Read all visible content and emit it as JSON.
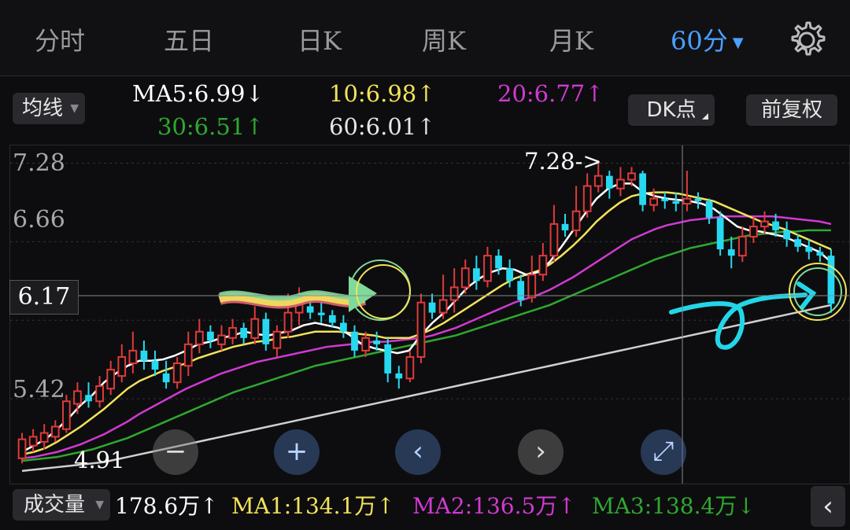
{
  "tabs": [
    {
      "label": "分时",
      "active": false
    },
    {
      "label": "五日",
      "active": false
    },
    {
      "label": "日K",
      "active": false
    },
    {
      "label": "周K",
      "active": false
    },
    {
      "label": "月K",
      "active": false
    },
    {
      "label": "60分",
      "active": true
    }
  ],
  "tab_active_caret": "▼",
  "ma_selector": "均线",
  "ma_values": {
    "ma5": "MA5:6.99↓",
    "ma10": "10:6.98↑",
    "ma20": "20:6.77↑",
    "ma30": "30:6.51↑",
    "ma60": "60:6.01↑"
  },
  "dk_button": "DK点",
  "adjust_button": "前复权",
  "price_axis": [
    "7.28",
    "6.66",
    "5.42"
  ],
  "current_price": "6.17",
  "high_marker": "7.28->",
  "low_marker": "4.91",
  "zoom_controls": {
    "minus": "−",
    "plus": "+",
    "prev": "‹",
    "next": "›",
    "expand": "⤢"
  },
  "volume_bar": {
    "selector": "成交量",
    "vol": "178.6万↑",
    "ma1": "MA1:134.1万↑",
    "ma2": "MA2:136.5万↑",
    "ma3": "MA3:138.4万↓"
  },
  "collapse_button": "‹",
  "colors": {
    "up": "#e03a3a",
    "down": "#27d9f0",
    "ma5": "#ffffff",
    "ma10": "#f2e35a",
    "ma20": "#d13ad1",
    "ma30": "#2fa82f",
    "ma60": "#d0d0d0",
    "accent": "#4aa0ff"
  },
  "chart_data": {
    "type": "candlestick",
    "ylim": [
      4.75,
      7.42
    ],
    "candles": [
      {
        "o": 4.95,
        "c": 5.1,
        "h": 5.15,
        "l": 4.91
      },
      {
        "o": 5.05,
        "c": 5.12,
        "h": 5.18,
        "l": 5.0
      },
      {
        "o": 5.08,
        "c": 5.15,
        "h": 5.22,
        "l": 5.02
      },
      {
        "o": 5.12,
        "c": 5.2,
        "h": 5.25,
        "l": 5.08
      },
      {
        "o": 5.18,
        "c": 5.4,
        "h": 5.45,
        "l": 5.15
      },
      {
        "o": 5.38,
        "c": 5.48,
        "h": 5.55,
        "l": 5.3
      },
      {
        "o": 5.45,
        "c": 5.4,
        "h": 5.55,
        "l": 5.35
      },
      {
        "o": 5.4,
        "c": 5.52,
        "h": 5.6,
        "l": 5.35
      },
      {
        "o": 5.5,
        "c": 5.65,
        "h": 5.72,
        "l": 5.45
      },
      {
        "o": 5.6,
        "c": 5.75,
        "h": 5.85,
        "l": 5.55
      },
      {
        "o": 5.7,
        "c": 5.8,
        "h": 5.95,
        "l": 5.62
      },
      {
        "o": 5.8,
        "c": 5.72,
        "h": 5.88,
        "l": 5.65
      },
      {
        "o": 5.72,
        "c": 5.65,
        "h": 5.8,
        "l": 5.6
      },
      {
        "o": 5.62,
        "c": 5.55,
        "h": 5.72,
        "l": 5.5
      },
      {
        "o": 5.55,
        "c": 5.7,
        "h": 5.75,
        "l": 5.5
      },
      {
        "o": 5.68,
        "c": 5.85,
        "h": 5.95,
        "l": 5.6
      },
      {
        "o": 5.85,
        "c": 5.95,
        "h": 6.05,
        "l": 5.78
      },
      {
        "o": 5.95,
        "c": 5.88,
        "h": 6.0,
        "l": 5.82
      },
      {
        "o": 5.85,
        "c": 5.92,
        "h": 6.0,
        "l": 5.8
      },
      {
        "o": 5.9,
        "c": 5.98,
        "h": 6.05,
        "l": 5.85
      },
      {
        "o": 5.98,
        "c": 5.9,
        "h": 6.02,
        "l": 5.85
      },
      {
        "o": 5.9,
        "c": 6.05,
        "h": 6.15,
        "l": 5.85
      },
      {
        "o": 6.05,
        "c": 5.85,
        "h": 6.1,
        "l": 5.8
      },
      {
        "o": 5.82,
        "c": 5.95,
        "h": 6.0,
        "l": 5.75
      },
      {
        "o": 5.95,
        "c": 6.1,
        "h": 6.25,
        "l": 5.9
      },
      {
        "o": 6.1,
        "c": 6.18,
        "h": 6.3,
        "l": 6.0
      },
      {
        "o": 6.15,
        "c": 6.1,
        "h": 6.2,
        "l": 6.05
      },
      {
        "o": 6.1,
        "c": 6.08,
        "h": 6.18,
        "l": 6.02
      },
      {
        "o": 6.08,
        "c": 6.02,
        "h": 6.12,
        "l": 5.98
      },
      {
        "o": 6.02,
        "c": 5.95,
        "h": 6.08,
        "l": 5.9
      },
      {
        "o": 5.95,
        "c": 5.8,
        "h": 6.0,
        "l": 5.75
      },
      {
        "o": 5.8,
        "c": 5.9,
        "h": 5.95,
        "l": 5.75
      },
      {
        "o": 5.88,
        "c": 5.85,
        "h": 5.95,
        "l": 5.8
      },
      {
        "o": 5.85,
        "c": 5.62,
        "h": 5.9,
        "l": 5.55
      },
      {
        "o": 5.62,
        "c": 5.58,
        "h": 5.68,
        "l": 5.5
      },
      {
        "o": 5.58,
        "c": 5.75,
        "h": 5.8,
        "l": 5.55
      },
      {
        "o": 5.75,
        "c": 6.18,
        "h": 6.25,
        "l": 5.7
      },
      {
        "o": 6.18,
        "c": 6.1,
        "h": 6.25,
        "l": 6.05
      },
      {
        "o": 6.1,
        "c": 6.2,
        "h": 6.4,
        "l": 6.05
      },
      {
        "o": 6.2,
        "c": 6.3,
        "h": 6.45,
        "l": 6.1
      },
      {
        "o": 6.3,
        "c": 6.45,
        "h": 6.52,
        "l": 6.25
      },
      {
        "o": 6.45,
        "c": 6.35,
        "h": 6.55,
        "l": 6.28
      },
      {
        "o": 6.35,
        "c": 6.55,
        "h": 6.62,
        "l": 6.3
      },
      {
        "o": 6.55,
        "c": 6.45,
        "h": 6.6,
        "l": 6.4
      },
      {
        "o": 6.45,
        "c": 6.35,
        "h": 6.52,
        "l": 6.3
      },
      {
        "o": 6.35,
        "c": 6.2,
        "h": 6.4,
        "l": 6.15
      },
      {
        "o": 6.22,
        "c": 6.4,
        "h": 6.55,
        "l": 6.18
      },
      {
        "o": 6.4,
        "c": 6.55,
        "h": 6.65,
        "l": 6.35
      },
      {
        "o": 6.55,
        "c": 6.8,
        "h": 6.95,
        "l": 6.5
      },
      {
        "o": 6.8,
        "c": 6.75,
        "h": 6.88,
        "l": 6.7
      },
      {
        "o": 6.75,
        "c": 6.9,
        "h": 7.1,
        "l": 6.7
      },
      {
        "o": 6.9,
        "c": 7.1,
        "h": 7.2,
        "l": 6.85
      },
      {
        "o": 7.1,
        "c": 7.18,
        "h": 7.28,
        "l": 7.05
      },
      {
        "o": 7.18,
        "c": 7.08,
        "h": 7.22,
        "l": 7.0
      },
      {
        "o": 7.08,
        "c": 7.15,
        "h": 7.25,
        "l": 7.02
      },
      {
        "o": 7.15,
        "c": 7.2,
        "h": 7.25,
        "l": 7.1
      },
      {
        "o": 7.2,
        "c": 6.95,
        "h": 7.22,
        "l": 6.9
      },
      {
        "o": 6.95,
        "c": 7.0,
        "h": 7.08,
        "l": 6.9
      },
      {
        "o": 7.0,
        "c": 6.98,
        "h": 7.05,
        "l": 6.92
      },
      {
        "o": 6.98,
        "c": 6.96,
        "h": 7.05,
        "l": 6.9
      },
      {
        "o": 6.96,
        "c": 7.0,
        "h": 7.22,
        "l": 6.9
      },
      {
        "o": 7.0,
        "c": 6.98,
        "h": 7.05,
        "l": 6.92
      },
      {
        "o": 6.98,
        "c": 6.85,
        "h": 7.0,
        "l": 6.8
      },
      {
        "o": 6.85,
        "c": 6.6,
        "h": 6.9,
        "l": 6.55
      },
      {
        "o": 6.6,
        "c": 6.55,
        "h": 6.7,
        "l": 6.45
      },
      {
        "o": 6.55,
        "c": 6.7,
        "h": 6.78,
        "l": 6.5
      },
      {
        "o": 6.7,
        "c": 6.78,
        "h": 6.85,
        "l": 6.65
      },
      {
        "o": 6.78,
        "c": 6.82,
        "h": 6.9,
        "l": 6.72
      },
      {
        "o": 6.82,
        "c": 6.75,
        "h": 6.88,
        "l": 6.7
      },
      {
        "o": 6.75,
        "c": 6.68,
        "h": 6.82,
        "l": 6.62
      },
      {
        "o": 6.68,
        "c": 6.62,
        "h": 6.72,
        "l": 6.58
      },
      {
        "o": 6.62,
        "c": 6.58,
        "h": 6.68,
        "l": 6.52
      },
      {
        "o": 6.58,
        "c": 6.55,
        "h": 6.62,
        "l": 6.5
      },
      {
        "o": 6.55,
        "c": 6.17,
        "h": 6.6,
        "l": 6.1
      }
    ],
    "ma_lines": {
      "ma5": [
        5.0,
        5.05,
        5.1,
        5.18,
        5.27,
        5.37,
        5.45,
        5.55,
        5.62,
        5.68,
        5.72,
        5.72,
        5.73,
        5.76,
        5.8,
        5.85,
        5.87,
        5.9,
        5.92,
        5.95,
        5.93,
        5.92,
        5.94,
        5.96,
        6.0,
        6.02,
        6.0,
        5.98,
        5.92,
        5.85,
        5.82,
        5.8,
        5.78,
        5.8,
        5.92,
        6.02,
        6.1,
        6.2,
        6.3,
        6.37,
        6.42,
        6.45,
        6.44,
        6.4,
        6.42,
        6.5,
        6.62,
        6.75,
        6.88,
        7.0,
        7.08,
        7.12,
        7.12,
        7.05,
        7.02,
        7.0,
        6.99,
        6.98,
        6.96,
        6.92,
        6.85,
        6.78,
        6.75,
        6.74,
        6.72,
        6.7,
        6.66,
        6.62,
        6.58,
        6.5
      ],
      "ma10": [
        4.98,
        5.0,
        5.03,
        5.08,
        5.14,
        5.2,
        5.27,
        5.34,
        5.42,
        5.5,
        5.56,
        5.6,
        5.64,
        5.67,
        5.7,
        5.74,
        5.77,
        5.8,
        5.83,
        5.85,
        5.87,
        5.88,
        5.9,
        5.91,
        5.93,
        5.95,
        5.95,
        5.95,
        5.94,
        5.93,
        5.92,
        5.9,
        5.9,
        5.9,
        5.93,
        5.97,
        6.02,
        6.08,
        6.14,
        6.2,
        6.26,
        6.32,
        6.37,
        6.4,
        6.43,
        6.48,
        6.55,
        6.63,
        6.72,
        6.82,
        6.9,
        6.97,
        7.02,
        7.04,
        7.05,
        7.05,
        7.04,
        7.02,
        7.0,
        6.98,
        6.94,
        6.9,
        6.86,
        6.82,
        6.79,
        6.76,
        6.72,
        6.68,
        6.64,
        6.6
      ],
      "ma20": [
        4.95,
        4.96,
        4.98,
        5.0,
        5.03,
        5.06,
        5.1,
        5.14,
        5.19,
        5.24,
        5.3,
        5.35,
        5.4,
        5.45,
        5.5,
        5.54,
        5.58,
        5.62,
        5.65,
        5.68,
        5.71,
        5.73,
        5.75,
        5.77,
        5.79,
        5.81,
        5.83,
        5.84,
        5.85,
        5.86,
        5.87,
        5.87,
        5.88,
        5.89,
        5.9,
        5.92,
        5.95,
        5.98,
        6.02,
        6.06,
        6.1,
        6.14,
        6.18,
        6.21,
        6.24,
        6.28,
        6.33,
        6.38,
        6.44,
        6.5,
        6.56,
        6.62,
        6.68,
        6.72,
        6.76,
        6.79,
        6.81,
        6.83,
        6.84,
        6.85,
        6.86,
        6.86,
        6.86,
        6.86,
        6.86,
        6.85,
        6.84,
        6.83,
        6.82,
        6.8
      ],
      "ma30": [
        4.93,
        4.94,
        4.95,
        4.96,
        4.98,
        5.0,
        5.02,
        5.05,
        5.08,
        5.11,
        5.15,
        5.19,
        5.23,
        5.27,
        5.31,
        5.35,
        5.39,
        5.43,
        5.47,
        5.5,
        5.53,
        5.56,
        5.59,
        5.62,
        5.65,
        5.68,
        5.7,
        5.72,
        5.74,
        5.76,
        5.78,
        5.8,
        5.82,
        5.84,
        5.86,
        5.88,
        5.9,
        5.92,
        5.95,
        5.98,
        6.01,
        6.04,
        6.07,
        6.1,
        6.13,
        6.16,
        6.2,
        6.24,
        6.28,
        6.32,
        6.36,
        6.4,
        6.44,
        6.48,
        6.52,
        6.55,
        6.58,
        6.61,
        6.63,
        6.65,
        6.67,
        6.69,
        6.71,
        6.72,
        6.73,
        6.74,
        6.74,
        6.75,
        6.75,
        6.75
      ],
      "ma60": [
        4.85,
        4.86,
        4.87,
        4.88,
        4.89,
        4.9,
        4.91,
        4.92,
        4.94,
        4.96,
        4.98,
        5.0,
        5.02,
        5.04,
        5.06,
        5.08,
        5.1,
        5.12,
        5.14,
        5.16,
        5.18,
        5.2,
        5.22,
        5.24,
        5.26,
        5.28,
        5.3,
        5.32,
        5.34,
        5.36,
        5.38,
        5.4,
        5.42,
        5.44,
        5.46,
        5.48,
        5.5,
        5.52,
        5.54,
        5.56,
        5.58,
        5.6,
        5.62,
        5.64,
        5.66,
        5.68,
        5.7,
        5.72,
        5.74,
        5.76,
        5.78,
        5.8,
        5.82,
        5.84,
        5.86,
        5.88,
        5.9,
        5.92,
        5.94,
        5.96,
        5.98,
        6.0,
        6.02,
        6.04,
        6.06,
        6.08,
        6.1,
        6.12,
        6.14,
        6.16
      ]
    }
  }
}
